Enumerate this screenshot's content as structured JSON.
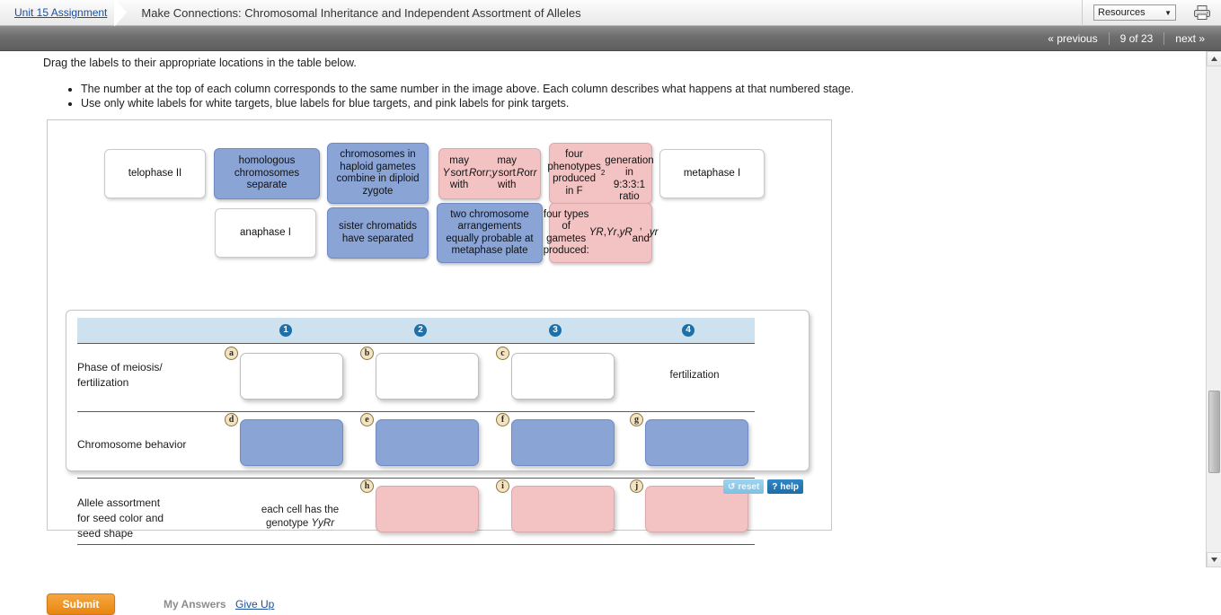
{
  "topbar": {
    "breadcrumb_link": "Unit 15 Assignment",
    "title": "Make Connections: Chromosomal Inheritance and Independent Assortment of Alleles",
    "resources_label": "Resources",
    "resources_caret": "▼",
    "print_icon": "printer-icon"
  },
  "nav": {
    "previous": "« previous",
    "counter": "9 of 23",
    "next": "next »"
  },
  "instructions": {
    "lead": "Drag the labels to their appropriate locations in the table below.",
    "bullets": [
      "The number at the top of each column corresponds to the same number in the image above. Each column describes what happens at that numbered stage.",
      "Use only white labels for white targets, blue labels for blue targets, and pink labels for pink targets."
    ]
  },
  "labels": {
    "row1": [
      {
        "id": "telophase-ii",
        "kind": "white",
        "text": "telophase II"
      },
      {
        "id": "homologous-chromosomes-separate",
        "kind": "blue",
        "text": "homologous chromosomes separate"
      },
      {
        "id": "chromosomes-haploid-gametes",
        "kind": "blue",
        "text": "chromosomes in haploid gametes combine in diploid zygote"
      },
      {
        "id": "y-may-sort",
        "kind": "pink",
        "html": "<i>Y</i> may sort with<br><i>R</i> or <i>r</i>; <i>y</i> may<br>sort with <i>R</i> or <i>r</i>"
      },
      {
        "id": "four-phenotypes",
        "kind": "pink",
        "html": "four phenotypes<br>produced in F<sub>2</sub><br>generation in<br>9:3:3:1 ratio"
      },
      {
        "id": "metaphase-i",
        "kind": "white",
        "text": "metaphase I"
      }
    ],
    "row2": [
      {
        "id": "anaphase-i",
        "kind": "white",
        "text": "anaphase I"
      },
      {
        "id": "sister-chromatids-separated",
        "kind": "blue",
        "text": "sister chromatids have separated"
      },
      {
        "id": "two-chromosome-arrangements",
        "kind": "blue",
        "text": "two chromosome arrangements equally probable at metaphase plate"
      },
      {
        "id": "four-types-gametes",
        "kind": "pink",
        "html": "four types of<br>gametes<br>produced: <i>YR</i>,<br><i>Yr</i>, <i>yR</i>, and <i>yr</i>"
      }
    ]
  },
  "table": {
    "columns": [
      "1",
      "2",
      "3",
      "4"
    ],
    "rows": [
      {
        "label": "Phase of meiosis/\nfertilization",
        "label_line1": "Phase of meiosis/",
        "label_line2": "fertilization",
        "targets": [
          "a",
          "b",
          "c"
        ],
        "target_kind": "white",
        "static_cell": "fertilization"
      },
      {
        "label": "Chromosome behavior",
        "targets": [
          "d",
          "e",
          "f",
          "g"
        ],
        "target_kind": "blue",
        "static_cell": ""
      },
      {
        "label_line1": "Allele assortment",
        "label_line2": "for seed color and",
        "label_line3": "seed shape",
        "targets": [
          "h",
          "i",
          "j"
        ],
        "target_kind": "pink",
        "static_cell_line1": "each cell has the",
        "static_cell_line2": "genotype YyRr"
      }
    ]
  },
  "controls": {
    "reset_label": "reset",
    "reset_icon": "↺",
    "help_label": "help",
    "help_icon": "?"
  },
  "footer": {
    "submit": "Submit",
    "my_answers": "My Answers",
    "give_up": "Give Up"
  },
  "colors": {
    "blue_target": "#8aa4d6",
    "pink_target": "#f3c3c3",
    "header_band": "#cde2ee",
    "number_circle": "#1f6fa8",
    "submit_orange": "#e8860f",
    "link_blue": "#1a4f9c"
  }
}
